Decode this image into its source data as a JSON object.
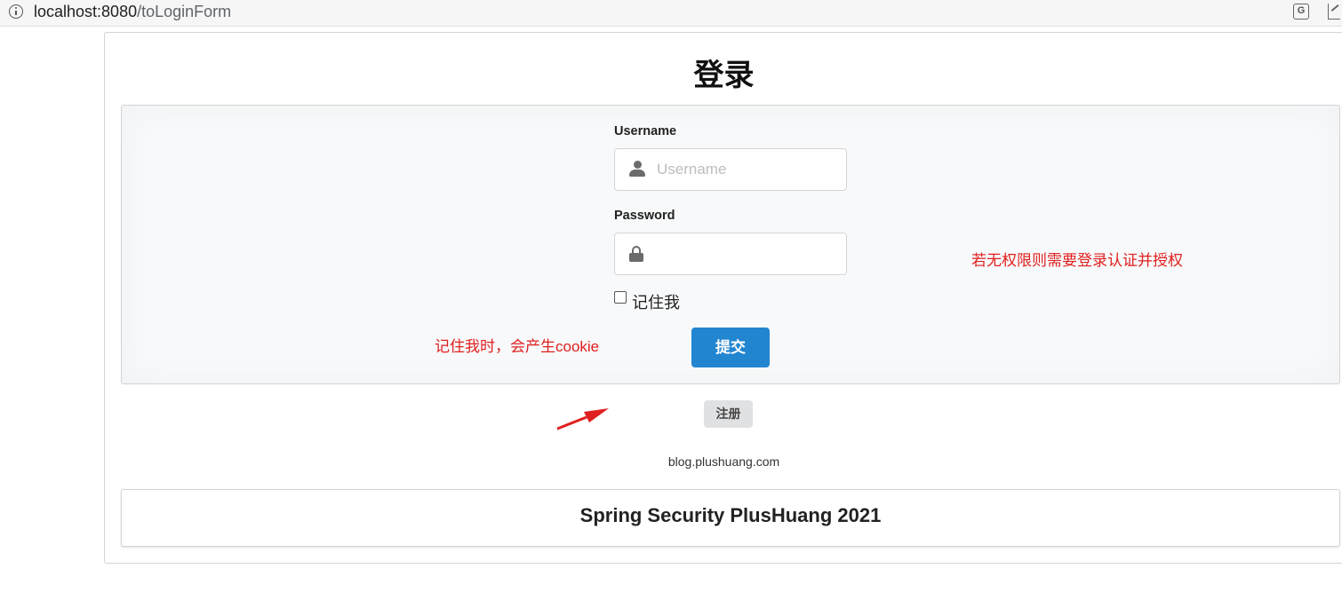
{
  "browser": {
    "url_host": "localhost:8080",
    "url_path": "/toLoginForm",
    "translate_icon_glyph": "G"
  },
  "page": {
    "title": "登录"
  },
  "form": {
    "username_label": "Username",
    "username_placeholder": "Username",
    "username_value": "",
    "password_label": "Password",
    "password_value": "",
    "remember_label": "记住我",
    "remember_checked": false,
    "submit_label": "提交"
  },
  "annotations": {
    "remember_note": "记住我时，会产生cookie",
    "auth_note": "若无权限则需要登录认证并授权",
    "color": "#e02020"
  },
  "register_label": "注册",
  "footer": {
    "link_text": "blog.plushuang.com",
    "title": "Spring Security PlusHuang 2021"
  },
  "colors": {
    "primary": "#2185d0",
    "secondary_button": "#e0e1e2",
    "segment_bg": "#f8f9fa"
  },
  "icons": {
    "address_bar": "info-icon",
    "username_field": "user-icon",
    "password_field": "lock-icon"
  }
}
